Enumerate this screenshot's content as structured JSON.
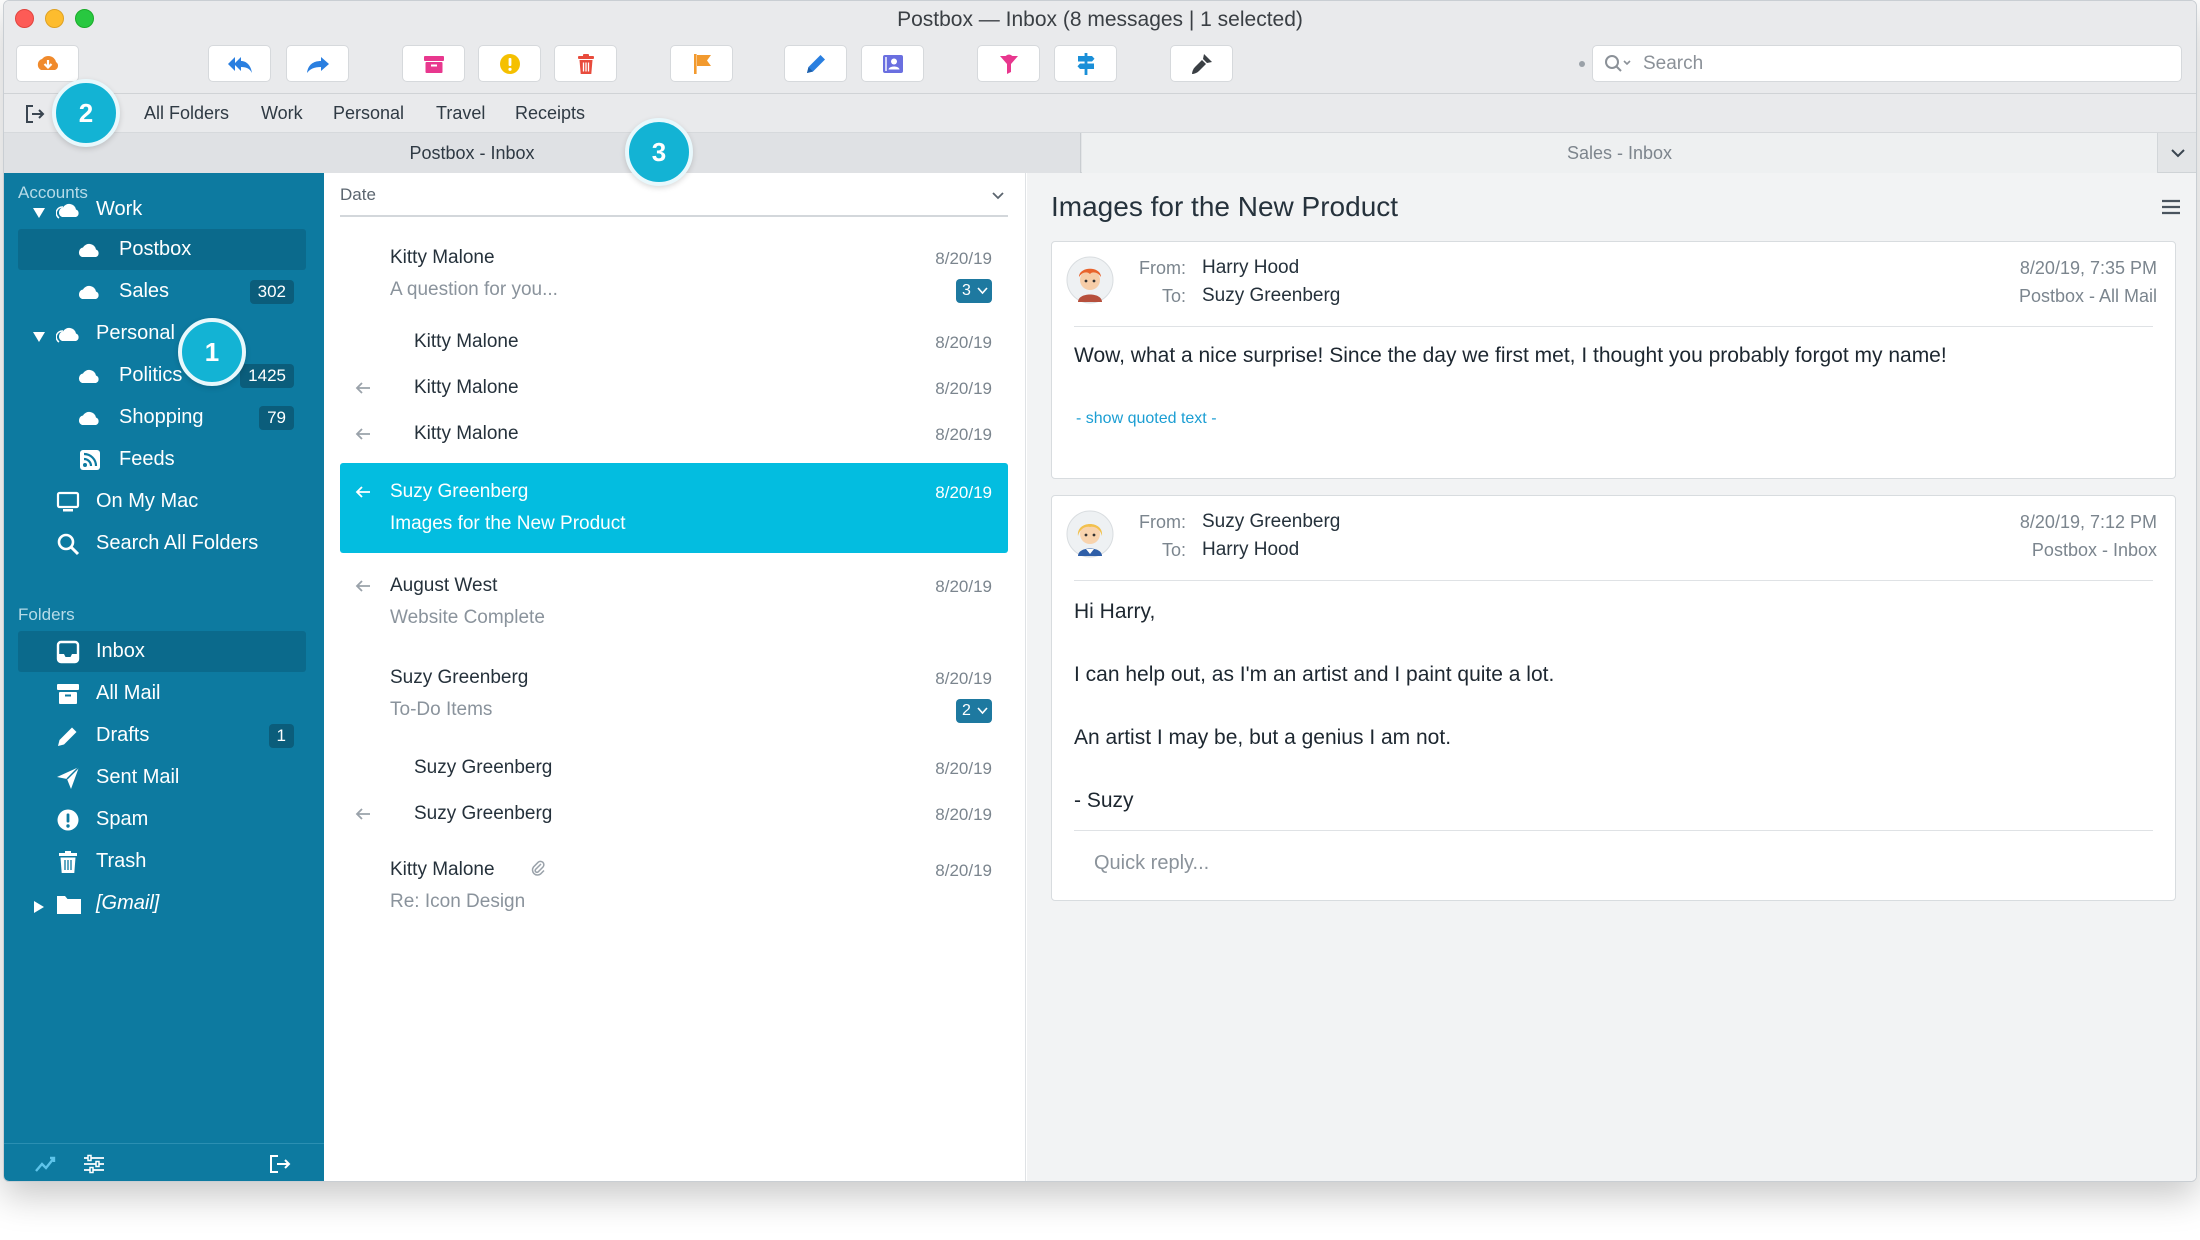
{
  "window": {
    "title": "Postbox — Inbox (8 messages | 1 selected)"
  },
  "toolbar": {
    "buttons": [
      {
        "name": "get-mail-button",
        "icon": "cloud-download-icon",
        "color": "#f08a2c"
      },
      {
        "name": "reply-all-button",
        "icon": "reply-all-icon",
        "color": "#2a7fe0"
      },
      {
        "name": "forward-button",
        "icon": "forward-icon",
        "color": "#2a7fe0"
      },
      {
        "name": "archive-button",
        "icon": "archive-icon",
        "color": "#e8378e"
      },
      {
        "name": "spam-button",
        "icon": "exclamation-icon",
        "color": "#f5c000"
      },
      {
        "name": "delete-button",
        "icon": "trash-icon",
        "color": "#e84b3c"
      },
      {
        "name": "flag-button",
        "icon": "flag-icon",
        "color": "#f29a2e"
      },
      {
        "name": "compose-button",
        "icon": "pencil-icon",
        "color": "#2a7fe0"
      },
      {
        "name": "contacts-button",
        "icon": "contacts-icon",
        "color": "#6a6fe0"
      },
      {
        "name": "focus-button",
        "icon": "funnel-icon",
        "color": "#e8378e"
      },
      {
        "name": "topics-button",
        "icon": "signpost-icon",
        "color": "#1a8fd8"
      },
      {
        "name": "customize-button",
        "icon": "brush-icon",
        "color": "#3a3f44"
      }
    ]
  },
  "search": {
    "placeholder": "Search"
  },
  "favorites": {
    "items": [
      "All Folders",
      "Work",
      "Personal",
      "Travel",
      "Receipts"
    ]
  },
  "tabs": {
    "active": "Postbox - Inbox",
    "inactive": "Sales - Inbox"
  },
  "sidebar": {
    "accounts_label": "Accounts",
    "folders_label": "Folders",
    "accounts": {
      "work": "Work",
      "postbox": "Postbox",
      "sales": "Sales",
      "sales_count": "302",
      "personal": "Personal",
      "politics": "Politics",
      "politics_count": "1425",
      "shopping": "Shopping",
      "shopping_count": "79",
      "feeds": "Feeds",
      "on_my_mac": "On My Mac",
      "search_all": "Search All Folders"
    },
    "folders": {
      "inbox": "Inbox",
      "all_mail": "All Mail",
      "drafts": "Drafts",
      "drafts_count": "1",
      "sent": "Sent Mail",
      "spam": "Spam",
      "trash": "Trash",
      "gmail": "[Gmail]"
    }
  },
  "message_list": {
    "sort_label": "Date",
    "messages": [
      {
        "sender": "Kitty Malone",
        "subject": "A question for you...",
        "date": "8/20/19",
        "thread_count": "3"
      },
      {
        "sender": "Kitty Malone",
        "date": "8/20/19"
      },
      {
        "sender": "Kitty Malone",
        "date": "8/20/19"
      },
      {
        "sender": "Kitty Malone",
        "date": "8/20/19"
      },
      {
        "sender": "Suzy Greenberg",
        "subject": "Images for the New Product",
        "date": "8/20/19"
      },
      {
        "sender": "August West",
        "subject": "Website Complete",
        "date": "8/20/19"
      },
      {
        "sender": "Suzy Greenberg",
        "subject": "To-Do Items",
        "date": "8/20/19",
        "thread_count": "2"
      },
      {
        "sender": "Suzy Greenberg",
        "date": "8/20/19"
      },
      {
        "sender": "Suzy Greenberg",
        "date": "8/20/19"
      },
      {
        "sender": "Kitty Malone",
        "subject": "Re: Icon Design",
        "date": "8/20/19"
      }
    ]
  },
  "reader": {
    "subject": "Images for the New Product",
    "messages": [
      {
        "from_label": "From:",
        "to_label": "To:",
        "from": "Harry Hood",
        "to": "Suzy Greenberg",
        "datetime": "8/20/19, 7:35 PM",
        "mailbox": "Postbox - All Mail",
        "body": [
          "Wow, what a nice surprise! Since the day we first met, I thought you probably forgot my name!"
        ],
        "quoted_toggle": "- show quoted text -"
      },
      {
        "from_label": "From:",
        "to_label": "To:",
        "from": "Suzy Greenberg",
        "to": "Harry Hood",
        "datetime": "8/20/19, 7:12 PM",
        "mailbox": "Postbox - Inbox",
        "body": [
          "Hi Harry,",
          "I can help out, as I'm an artist and I paint quite a lot.",
          "An artist I may be, but a genius I am not.",
          "- Suzy"
        ],
        "quick_reply_placeholder": "Quick reply..."
      }
    ]
  },
  "callouts": [
    "1",
    "2",
    "3"
  ],
  "colors": {
    "sidebar": "#0d7aa0",
    "selection": "#03bde0",
    "callout": "#13b3d4"
  }
}
